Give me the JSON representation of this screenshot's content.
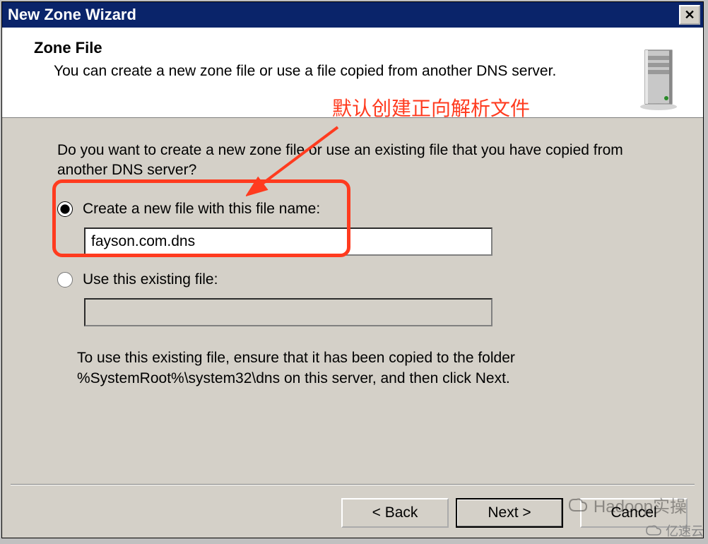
{
  "title": "New Zone Wizard",
  "header": {
    "title": "Zone File",
    "desc": "You can create a new zone file or use a file copied from another DNS server."
  },
  "body": {
    "question": "Do you want to create a new zone file or use an existing file that you have copied from another DNS server?",
    "option1_label": "Create a new file with this file name:",
    "option1_value": "fayson.com.dns",
    "option2_label": "Use this existing file:",
    "option2_value": "",
    "note": "To use this existing file, ensure that it has been copied to the folder %SystemRoot%\\system32\\dns on this server, and then click Next."
  },
  "buttons": {
    "back": "< Back",
    "next": "Next >",
    "cancel": "Cancel"
  },
  "annotation": "默认创建正向解析文件",
  "watermark1": "Hadoop实操",
  "watermark2": "亿速云"
}
